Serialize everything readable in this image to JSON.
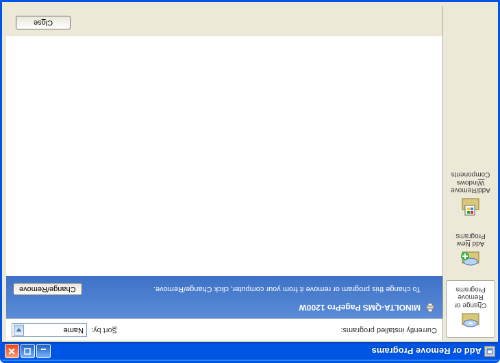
{
  "window": {
    "title": "Add or Remove Programs"
  },
  "sidebar": {
    "items": [
      {
        "label": "Change or Remove Programs"
      },
      {
        "label": "Add New Programs"
      },
      {
        "label": "Add/Remove Windows Components"
      }
    ]
  },
  "main": {
    "list_label": "Currently installed programs:",
    "sort_label": "Sort by:",
    "sort_value": "Name"
  },
  "program": {
    "name": "MINOLTA-QMS PagePro 1200W",
    "hint": "To change this program or remove it from your computer, click Change/Remove.",
    "action_label": "Change/Remove"
  },
  "footer": {
    "close_label": "Close"
  }
}
